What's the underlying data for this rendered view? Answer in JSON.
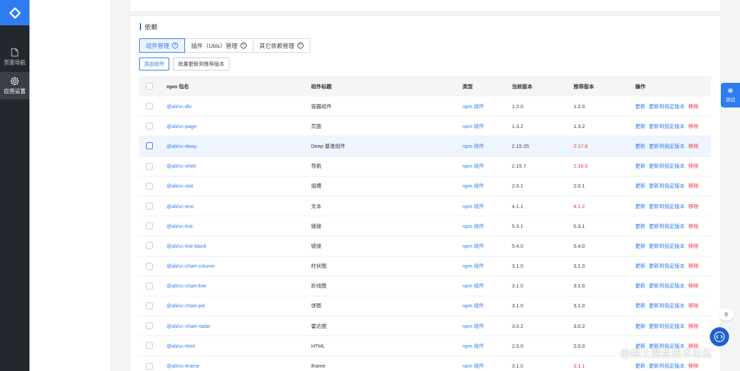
{
  "rail": {
    "items": [
      {
        "label": "页面导航",
        "active": false
      },
      {
        "label": "应用设置",
        "active": true
      }
    ]
  },
  "section": {
    "title": "依赖"
  },
  "tabs": [
    {
      "label": "组件管理",
      "active": true,
      "help": "?"
    },
    {
      "label": "插件（Utils）管理",
      "active": false,
      "help": "?"
    },
    {
      "label": "其它依赖管理",
      "active": false,
      "help": "?"
    }
  ],
  "buttons": {
    "add": "添加组件",
    "batch_update": "批量更新到推荐版本"
  },
  "table": {
    "headers": {
      "package": "npm 包名",
      "title": "组件标题",
      "type": "类型",
      "current": "当前版本",
      "recommended": "推荐版本",
      "actions": "操作"
    },
    "action_labels": {
      "update": "更新",
      "update_to": "更新到指定版本",
      "remove": "移除"
    },
    "rows": [
      {
        "package": "@ali/vc-div",
        "title": "容器组件",
        "type": "npm 组件",
        "current": "1.2.0",
        "recommended": "1.2.0",
        "outdated": false
      },
      {
        "package": "@ali/vc-page",
        "title": "页面",
        "type": "npm 组件",
        "current": "1.3.2",
        "recommended": "1.3.2",
        "outdated": false
      },
      {
        "package": "@ali/vc-deep",
        "title": "Deep 基准组件",
        "type": "npm 组件",
        "current": "2.15.25",
        "recommended": "2.17.8",
        "outdated": true
      },
      {
        "package": "@ali/vc-shell",
        "title": "导航",
        "type": "npm 组件",
        "current": "2.15.7",
        "recommended": "2.16.0",
        "outdated": true
      },
      {
        "package": "@ali/vc-slot",
        "title": "插槽",
        "type": "npm 组件",
        "current": "2.0.1",
        "recommended": "2.0.1",
        "outdated": false
      },
      {
        "package": "@ali/vc-text",
        "title": "文本",
        "type": "npm 组件",
        "current": "4.1.1",
        "recommended": "4.1.2",
        "outdated": true
      },
      {
        "package": "@ali/vc-link",
        "title": "链接",
        "type": "npm 组件",
        "current": "5.3.1",
        "recommended": "5.3.1",
        "outdated": false
      },
      {
        "package": "@ali/vc-link-block",
        "title": "链接",
        "type": "npm 组件",
        "current": "5.4.0",
        "recommended": "5.4.0",
        "outdated": false
      },
      {
        "package": "@ali/vc-chart-column",
        "title": "柱状图",
        "type": "npm 组件",
        "current": "3.1.0",
        "recommended": "3.1.0",
        "outdated": false
      },
      {
        "package": "@ali/vc-chart-line",
        "title": "折线图",
        "type": "npm 组件",
        "current": "3.1.0",
        "recommended": "3.1.0",
        "outdated": false
      },
      {
        "package": "@ali/vc-chart-pie",
        "title": "饼图",
        "type": "npm 组件",
        "current": "3.1.0",
        "recommended": "3.1.0",
        "outdated": false
      },
      {
        "package": "@ali/vc-chart-radar",
        "title": "雷达图",
        "type": "npm 组件",
        "current": "3.0.2",
        "recommended": "3.0.2",
        "outdated": false
      },
      {
        "package": "@ali/vc-html",
        "title": "HTML",
        "type": "npm 组件",
        "current": "2.0.0",
        "recommended": "2.0.0",
        "outdated": false
      },
      {
        "package": "@ali/vc-iframe",
        "title": "iframe",
        "type": "npm 组件",
        "current": "3.1.0",
        "recommended": "3.1.1",
        "outdated": true
      }
    ]
  },
  "float": {
    "test_label": "测试"
  },
  "watermark": "@稀土掘金技术社区",
  "colors": {
    "accent": "#2f7bf0",
    "danger": "#e8353b",
    "rail": "#23272e"
  }
}
